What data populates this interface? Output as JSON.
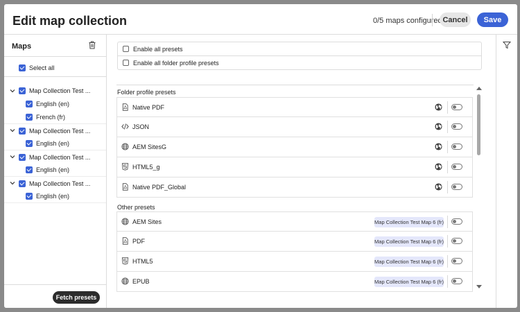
{
  "dialog": {
    "title": "Edit map collection",
    "status": "0/5 maps configured",
    "cancel_label": "Cancel",
    "save_label": "Save"
  },
  "sidebar": {
    "title": "Maps",
    "select_all_label": "Select all",
    "groups": [
      {
        "label": "Map Collection Test ...",
        "languages": [
          "English (en)",
          "French (fr)"
        ]
      },
      {
        "label": "Map Collection Test ...",
        "languages": [
          "English (en)"
        ]
      },
      {
        "label": "Map Collection Test ...",
        "languages": [
          "English (en)"
        ]
      },
      {
        "label": "Map Collection Test ...",
        "languages": [
          "English (en)"
        ]
      }
    ],
    "fetch_label": "Fetch presets"
  },
  "options": {
    "enable_all_label": "Enable all presets",
    "enable_folder_label": "Enable all folder profile presets"
  },
  "folder_section": {
    "title": "Folder profile presets",
    "rows": [
      {
        "name": "Native PDF",
        "icon": "pdf-icon"
      },
      {
        "name": "JSON",
        "icon": "code-icon"
      },
      {
        "name": "AEM SitesG",
        "icon": "globe-icon"
      },
      {
        "name": "HTML5_g",
        "icon": "html5-icon"
      },
      {
        "name": "Native PDF_Global",
        "icon": "pdf-icon"
      }
    ]
  },
  "other_section": {
    "title": "Other presets",
    "rows": [
      {
        "name": "AEM Sites",
        "icon": "globe-icon",
        "badge": "Map Collection Test Map 6 (fr)"
      },
      {
        "name": "PDF",
        "icon": "pdf-icon",
        "badge": "Map Collection Test Map 6 (fr)"
      },
      {
        "name": "HTML5",
        "icon": "html5-icon",
        "badge": "Map Collection Test Map 6 (fr)"
      },
      {
        "name": "EPUB",
        "icon": "globe-icon",
        "badge": "Map Collection Test Map 6 (fr)"
      }
    ]
  },
  "colors": {
    "accent": "#3b63d6",
    "badge_bg": "#e4e7fb",
    "fetch_bg": "#2c2c2c"
  }
}
